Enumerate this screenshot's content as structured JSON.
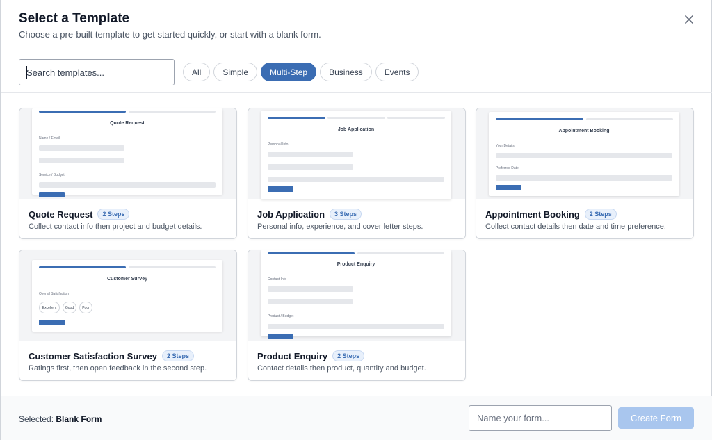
{
  "header": {
    "title": "Select a Template",
    "subtitle": "Choose a pre-built template to get started quickly, or start with a blank form."
  },
  "search": {
    "placeholder": "Search templates..."
  },
  "filters": [
    {
      "label": "All",
      "active": false
    },
    {
      "label": "Simple",
      "active": false
    },
    {
      "label": "Multi-Step",
      "active": true
    },
    {
      "label": "Business",
      "active": false
    },
    {
      "label": "Events",
      "active": false
    }
  ],
  "templates": [
    {
      "name": "Quote Request",
      "badge": "2 Steps",
      "description": "Collect contact info then project and budget details.",
      "preview": {
        "title": "Quote Request",
        "label1": "Name / Email",
        "label2": "Service / Budget"
      }
    },
    {
      "name": "Job Application",
      "badge": "3 Steps",
      "description": "Personal info, experience, and cover letter steps.",
      "preview": {
        "title": "Job Application",
        "label1": "Personal Info"
      }
    },
    {
      "name": "Appointment Booking",
      "badge": "2 Steps",
      "description": "Collect contact details then date and time preference.",
      "preview": {
        "title": "Appointment Booking",
        "label1": "Your Details",
        "label2": "Preferred Date"
      }
    },
    {
      "name": "Customer Satisfaction Survey",
      "badge": "2 Steps",
      "description": "Ratings first, then open feedback in the second step.",
      "preview": {
        "title": "Customer Survey",
        "label1": "Overall Satisfaction",
        "options": [
          "Excellent",
          "Good",
          "Poor"
        ]
      }
    },
    {
      "name": "Product Enquiry",
      "badge": "2 Steps",
      "description": "Contact details then product, quantity and budget.",
      "preview": {
        "title": "Product Enquiry",
        "label1": "Contact Info",
        "label2": "Product / Budget"
      }
    }
  ],
  "footer": {
    "selected_label": "Selected:",
    "selected_value": "Blank Form",
    "name_placeholder": "Name your form...",
    "create_label": "Create Form"
  },
  "colors": {
    "accent": "#3b6db3",
    "create_disabled": "#a9c6ee"
  },
  "icons": {
    "close": "close-icon"
  }
}
